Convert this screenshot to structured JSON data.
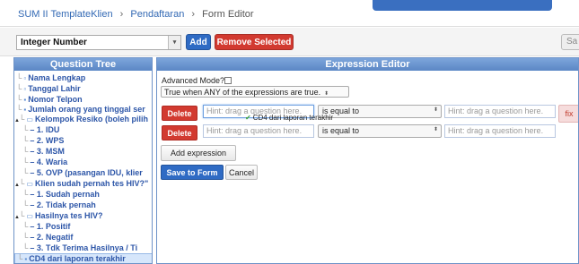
{
  "breadcrumb": {
    "template": "SUM II TemplateKlien",
    "sep1": "›",
    "registration": "Pendaftaran",
    "sep2": "›",
    "current": "Form Editor"
  },
  "toolbar": {
    "question_type": "Integer Number",
    "add_label": "Add",
    "remove_label": "Remove Selected",
    "save_partial": "Sa"
  },
  "question_tree": {
    "title": "Question Tree",
    "items": [
      {
        "label": "Nama Lengkap"
      },
      {
        "label": "Tanggal Lahir"
      },
      {
        "label": "Nomor Telpon"
      },
      {
        "label": "Jumlah orang yang tinggal ser"
      },
      {
        "label": "Kelompok Resiko (boleh pilih"
      },
      {
        "label": "– 1. IDU"
      },
      {
        "label": "– 2. WPS"
      },
      {
        "label": "– 3. MSM"
      },
      {
        "label": "– 4. Waria"
      },
      {
        "label": "– 5. OVP (pasangan IDU, klier"
      },
      {
        "label": "Klien sudah pernah tes HIV?\""
      },
      {
        "label": "– 1. Sudah pernah"
      },
      {
        "label": "– 2. Tidak pernah"
      },
      {
        "label": "Hasilnya tes HIV?"
      },
      {
        "label": "– 1. Positif"
      },
      {
        "label": "– 2. Negatif"
      },
      {
        "label": "– 3. Tdk Terima Hasilnya / Ti"
      },
      {
        "label": "CD4 dari laporan terakhir"
      }
    ]
  },
  "expression_editor": {
    "title": "Expression Editor",
    "advanced_mode_label": "Advanced Mode?",
    "mode_select": "True when ANY of the expressions are true.",
    "rows": [
      {
        "delete_label": "Delete",
        "left_placeholder": "Hint: drag a question here.",
        "operator": "is equal to",
        "right_placeholder": "Hint: drag a question here."
      },
      {
        "delete_label": "Delete",
        "left_placeholder": "Hint: drag a question here.",
        "operator": "is equal to",
        "right_placeholder": "Hint: drag a question here."
      }
    ],
    "dragging_label": "CD4 dari laporan terakhir",
    "fix_label": "fix",
    "add_expression_label": "Add expression",
    "save_label": "Save to Form",
    "cancel_label": "Cancel"
  },
  "colors": {
    "primary": "#2f6bc4",
    "danger": "#d23a30",
    "panel_header": "#5b87c5"
  }
}
